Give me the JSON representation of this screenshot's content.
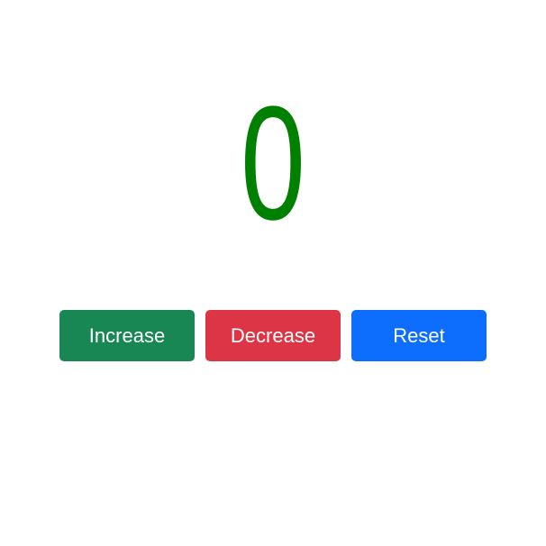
{
  "counter": {
    "value": "0",
    "color": "#008000"
  },
  "buttons": {
    "increase": {
      "label": "Increase",
      "color": "#198754"
    },
    "decrease": {
      "label": "Decrease",
      "color": "#dc3545"
    },
    "reset": {
      "label": "Reset",
      "color": "#0d6efd"
    }
  }
}
